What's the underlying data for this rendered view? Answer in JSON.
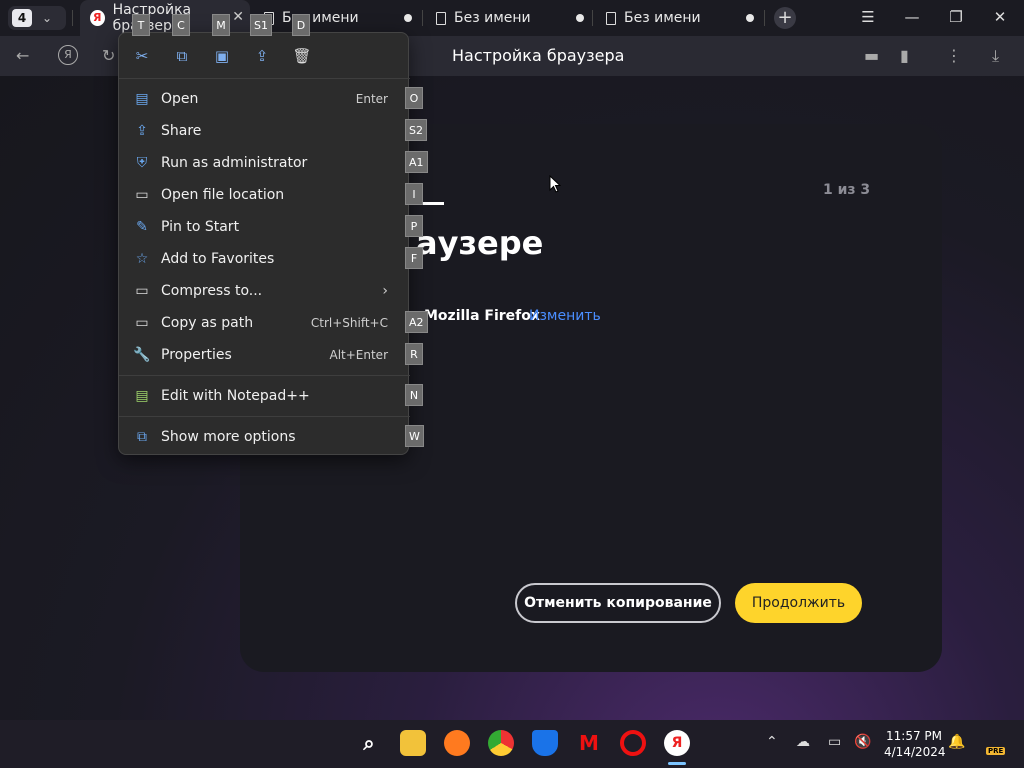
{
  "browser": {
    "tab_count": "4",
    "tabs": [
      {
        "label": "Настройка браузера"
      },
      {
        "label": "Без имени"
      },
      {
        "label": "Без имени"
      },
      {
        "label": "Без имени"
      }
    ],
    "page_title": "Настройка браузера"
  },
  "card": {
    "step": "1 из 3",
    "heading": "аузере",
    "source_label": "Mozilla Firefox",
    "change_link": "Изменить",
    "cancel_button": "Отменить копирование",
    "continue_button": "Продолжить"
  },
  "context_menu": {
    "quick_actions": [
      {
        "icon": "cut-icon",
        "badge": "T"
      },
      {
        "icon": "copy-icon",
        "badge": "C"
      },
      {
        "icon": "rename-icon",
        "badge": "M"
      },
      {
        "icon": "share-icon",
        "badge": "S1"
      },
      {
        "icon": "delete-icon",
        "badge": "D"
      }
    ],
    "items": [
      {
        "label": "Open",
        "shortcut": "Enter",
        "badge": "O",
        "icon": "open-icon"
      },
      {
        "label": "Share",
        "shortcut": "",
        "badge": "S2",
        "icon": "share-icon"
      },
      {
        "label": "Run as administrator",
        "shortcut": "",
        "badge": "A1",
        "icon": "shield-icon"
      },
      {
        "label": "Open file location",
        "shortcut": "",
        "badge": "I",
        "icon": "folder-icon"
      },
      {
        "label": "Pin to Start",
        "shortcut": "",
        "badge": "P",
        "icon": "pin-icon"
      },
      {
        "label": "Add to Favorites",
        "shortcut": "",
        "badge": "F",
        "icon": "star-icon"
      },
      {
        "label": "Compress to...",
        "shortcut": "",
        "badge": "",
        "icon": "archive-icon"
      },
      {
        "label": "Copy as path",
        "shortcut": "Ctrl+Shift+C",
        "badge": "A2",
        "icon": "path-icon"
      },
      {
        "label": "Properties",
        "shortcut": "Alt+Enter",
        "badge": "R",
        "icon": "wrench-icon"
      },
      {
        "label": "Edit with Notepad++",
        "shortcut": "",
        "badge": "N",
        "icon": "notepad-icon"
      },
      {
        "label": "Show more options",
        "shortcut": "",
        "badge": "W",
        "icon": "more-options-icon"
      }
    ]
  },
  "taskbar": {
    "time": "11:57 PM",
    "date": "4/14/2024",
    "tray_badge": "PRE"
  }
}
